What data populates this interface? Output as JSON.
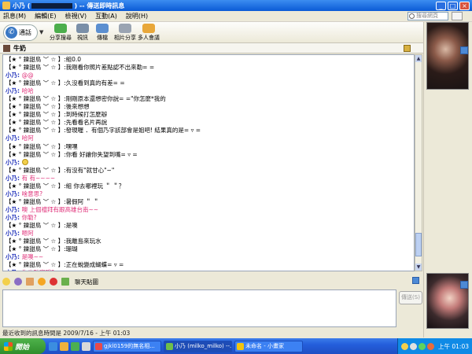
{
  "window": {
    "title_prefix": "小乃 (",
    "title_suffix": ") -- 傳送即時訊息"
  },
  "menu": [
    "訊息(M)",
    "編輯(E)",
    "檢視(V)",
    "互動(A)",
    "說明(H)"
  ],
  "search_placeholder": "搜尋網頁",
  "toolbar": {
    "call_label": "通話",
    "tools": [
      "分享搜尋",
      "視訊",
      "傳檔",
      "相片分享",
      "多人會議"
    ]
  },
  "contact_name": "牛奶",
  "conversation": [
    {
      "who": "them",
      "name": "【★ ° 鑠甜鳥 ﹀ ☆ 】",
      "text": ":組0.0"
    },
    {
      "who": "them",
      "name": "【★ ° 鑠甜鳥 ﹀ ☆ 】",
      "text": ":我剛看你照片差點認不出來勒= ="
    },
    {
      "who": "me",
      "name": "小乃",
      "text": "@@"
    },
    {
      "who": "them",
      "name": "【★ ° 鑠甜鳥 ﹀ ☆ 】",
      "text": ":久沒看到真的有差= ="
    },
    {
      "who": "me",
      "name": "小乃",
      "text": "哈哈"
    },
    {
      "who": "them",
      "name": "【★ ° 鑠甜鳥 ﹀ ☆ 】",
      "text": ":剛剛原本還想密你說= =\"你怎麼*我的"
    },
    {
      "who": "them",
      "name": "【★ ° 鑠甜鳥 ﹀ ☆ 】",
      "text": ":後來想想"
    },
    {
      "who": "them",
      "name": "【★ ° 鑠甜鳥 ﹀ ☆ 】",
      "text": ":到時候打怎麼辦"
    },
    {
      "who": "them",
      "name": "【★ ° 鑠甜鳥 ﹀ ☆ 】",
      "text": ":先看看名片再說"
    },
    {
      "who": "them",
      "name": "【★ ° 鑠甜鳥 ﹀ ☆ 】",
      "text": ":發現喔 ．有個乃字該部會是姐吧! 結果真的是= ▿ ="
    },
    {
      "who": "me",
      "name": "小乃",
      "text": "哈阿"
    },
    {
      "who": "them",
      "name": "【★ ° 鑠甜鳥 ﹀ ☆ 】",
      "text": ":嘿嘿"
    },
    {
      "who": "them",
      "name": "【★ ° 鑠甜鳥 ﹀ ☆ 】",
      "text": ":你看  好讓你失望到嘴= ▿ ="
    },
    {
      "who": "me",
      "name": "小乃",
      "text": "",
      "emoticon": true
    },
    {
      "who": "them",
      "name": "【★ ° 鑠甜鳥 ﹀ ☆ 】",
      "text": ":有沒有\"就甘心\"~\""
    },
    {
      "who": "me",
      "name": "小乃",
      "text": "有 有~~~~"
    },
    {
      "who": "them",
      "name": "【★ ° 鑠甜鳥 ﹀ ☆ 】",
      "text": ":組  你去哪裡玩 ＂ ＂？"
    },
    {
      "who": "me",
      "name": "小乃",
      "text": "啥意思?"
    },
    {
      "who": "them",
      "name": "【★ ° 鑠甜鳥 ﹀ ☆ 】",
      "text": ":暑假阿 ＂ ＂"
    },
    {
      "who": "me",
      "name": "小乃",
      "text": "噢  上個禮拜有跟高雄台南~~"
    },
    {
      "who": "me",
      "name": "小乃",
      "text": "你勒?"
    },
    {
      "who": "them",
      "name": "【★ ° 鑠甜鳥 ﹀ ☆ 】",
      "text": ":是噢"
    },
    {
      "who": "me",
      "name": "小乃",
      "text": "嗯阿"
    },
    {
      "who": "them",
      "name": "【★ ° 鑠甜鳥 ﹀ ☆ 】",
      "text": ":我離島來玩水"
    },
    {
      "who": "them",
      "name": "【★ ° 鑠甜鳥 ﹀ ☆ 】",
      "text": ":珊瑚"
    },
    {
      "who": "me",
      "name": "小乃",
      "text": "是噢~~"
    },
    {
      "who": "them",
      "name": "【★ ° 鑠甜鳥 ﹀ ☆ 】",
      "text": ":正在蛻變成蝴蝶= ▿ ="
    },
    {
      "who": "me",
      "name": "小乃",
      "text": "你也點寶哦?"
    },
    {
      "who": "me",
      "name": "小乃",
      "text": "嗚~ ▿ ~"
    }
  ],
  "sticker_label": "聊天貼圖",
  "send_label": "傳送(S)",
  "status_text": "最近收到的訊息時間是 2009/7/16 - 上午 01:03",
  "taskbar": {
    "start_label": "開始",
    "tasks": [
      "gjkl0159的無名相...",
      "小乃 (milko_milko) --...",
      "未命名 - 小畫家"
    ],
    "clock": "上午 01:03"
  }
}
